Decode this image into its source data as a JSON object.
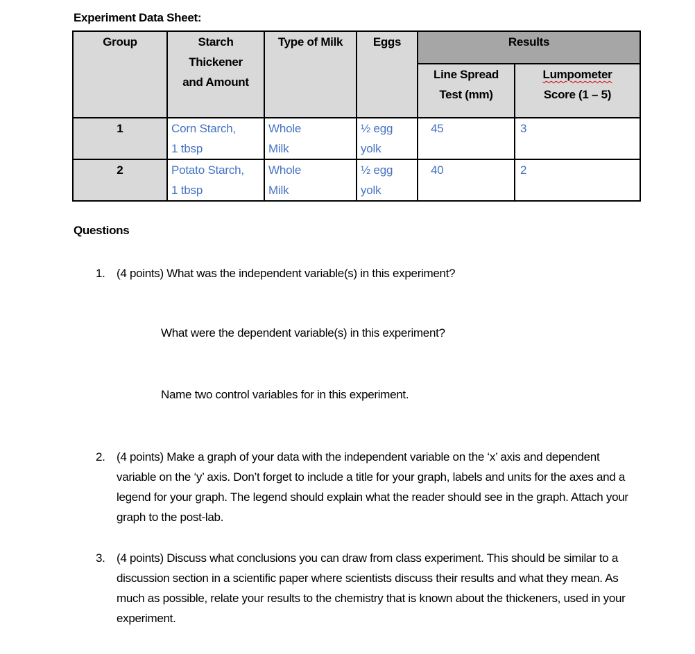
{
  "document": {
    "sheet_title": "Experiment Data Sheet:",
    "table": {
      "headers": {
        "group": "Group",
        "starch_line1": "Starch",
        "starch_line2": "Thickener",
        "starch_line3": "and Amount",
        "milk": "Type of Milk",
        "eggs": "Eggs",
        "results": "Results",
        "line_spread_line1": "Line Spread",
        "line_spread_line2": "Test (mm)",
        "lumpometer_line1": "Lumpometer",
        "lumpometer_line2": "Score (1 – 5)"
      },
      "rows": [
        {
          "group": "1",
          "starch_line1": "Corn Starch,",
          "starch_line2": "1 tbsp",
          "milk_line1": "Whole",
          "milk_line2": "Milk",
          "eggs_line1": "½ egg",
          "eggs_line2": "yolk",
          "line_spread": "45",
          "lumpometer": "3"
        },
        {
          "group": "2",
          "starch_line1": "Potato Starch,",
          "starch_line2": "1 tbsp",
          "milk_line1": "Whole",
          "milk_line2": "Milk",
          "eggs_line1": "½ egg",
          "eggs_line2": "yolk",
          "line_spread": "40",
          "lumpometer": "2"
        }
      ]
    },
    "questions_heading": "Questions",
    "questions": [
      {
        "number": "1.",
        "text": "(4 points) What was the independent variable(s) in this experiment?",
        "sub_questions": [
          "What were the dependent variable(s) in this experiment?",
          "Name two control variables for in this experiment."
        ]
      },
      {
        "number": "2.",
        "text": "(4 points) Make a graph of your data with the independent variable on the ‘x’ axis and dependent variable on the ‘y’ axis.  Don’t forget to include a title for your graph, labels and units for the axes and a legend for your graph.  The legend should explain what the reader should see in the graph. Attach your graph to the post-lab."
      },
      {
        "number": "3.",
        "text": "(4 points) Discuss what conclusions you can draw from class experiment.  This should be similar to a discussion section in a scientific paper where scientists discuss their results and what they mean.  As much as possible, relate your results to the chemistry that is known about the thickeners, used in your experiment."
      }
    ]
  },
  "colors": {
    "header_gray": "#d9d9d9",
    "results_header_gray": "#a6a6a6",
    "value_blue": "#4472c4",
    "spellcheck_red": "#d00000"
  }
}
